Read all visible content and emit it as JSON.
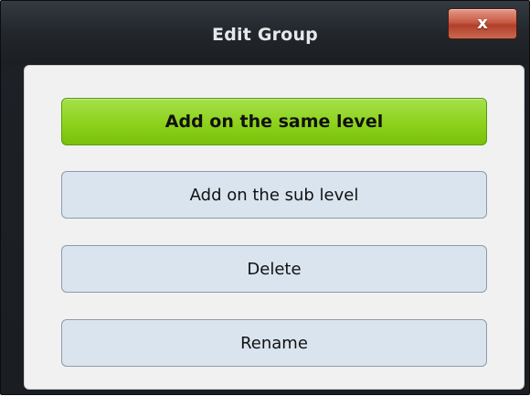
{
  "dialog": {
    "title": "Edit Group",
    "close_label": "x"
  },
  "buttons": {
    "add_same_level": "Add on the same level",
    "add_sub_level": "Add on the sub level",
    "delete": "Delete",
    "rename": "Rename"
  },
  "colors": {
    "primary_button": "#8fd31f",
    "secondary_button": "#d9e4ee",
    "close_button": "#c75a44",
    "title_bar": "#22262b"
  }
}
